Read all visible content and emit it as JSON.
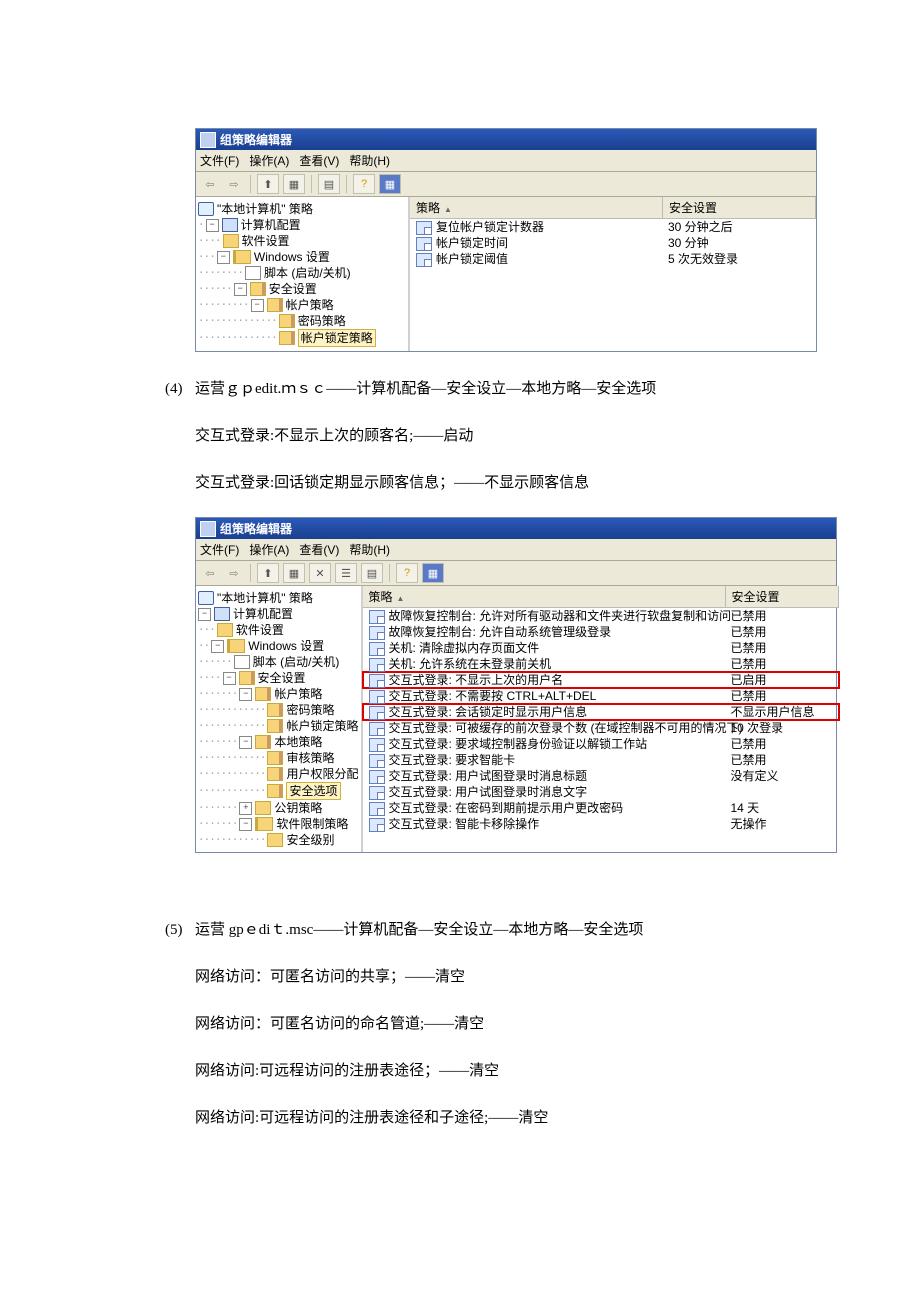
{
  "win1": {
    "title": "组策略编辑器",
    "menu": {
      "file": "文件(F)",
      "action": "操作(A)",
      "view": "查看(V)",
      "help": "帮助(H)"
    },
    "tree": {
      "root": "\"本地计算机\" 策略",
      "comp": "计算机配置",
      "soft": "软件设置",
      "wset": "Windows 设置",
      "script": "脚本 (启动/关机)",
      "sec": "安全设置",
      "acct": "帐户策略",
      "pwd": "密码策略",
      "lock": "帐户锁定策略"
    },
    "hdr": {
      "policy": "策略",
      "setting": "安全设置"
    },
    "rows": [
      {
        "p": "复位帐户锁定计数器",
        "v": "30 分钟之后"
      },
      {
        "p": "帐户锁定时间",
        "v": "30 分钟"
      },
      {
        "p": "帐户锁定阈值",
        "v": "5 次无效登录"
      }
    ]
  },
  "text": {
    "item4": "(4)",
    "p4a": "运营ｇｐedit.ｍｓｃ——计算机配备—安全设立—本地方略—安全选项",
    "p4b": "交互式登录:不显示上次的顾客名;——启动",
    "p4c": "交互式登录:回话锁定期显示顾客信息；——不显示顾客信息",
    "item5": "(5)",
    "p5a": "运营 gpｅdiｔ.msc——计算机配备—安全设立—本地方略—安全选项",
    "p5b": "网络访问：可匿名访问的共享；——清空",
    "p5c": "网络访问：可匿名访问的命名管道;——清空",
    "p5d": "网络访问:可远程访问的注册表途径；——清空",
    "p5e": "网络访问:可远程访问的注册表途径和子途径;——清空"
  },
  "win2": {
    "title": "组策略编辑器",
    "menu": {
      "file": "文件(F)",
      "action": "操作(A)",
      "view": "查看(V)",
      "help": "帮助(H)"
    },
    "tree": {
      "root": "\"本地计算机\" 策略",
      "comp": "计算机配置",
      "soft": "软件设置",
      "wset": "Windows 设置",
      "script": "脚本 (启动/关机)",
      "sec": "安全设置",
      "acct": "帐户策略",
      "pwd": "密码策略",
      "lock": "帐户锁定策略",
      "local": "本地策略",
      "audit": "审核策略",
      "rights": "用户权限分配",
      "secopt": "安全选项",
      "pubkey": "公钥策略",
      "swrest": "软件限制策略",
      "seclvl": "安全级别"
    },
    "hdr": {
      "policy": "策略",
      "setting": "安全设置"
    },
    "rows": [
      {
        "p": "故障恢复控制台: 允许对所有驱动器和文件夹进行软盘复制和访问",
        "v": "已禁用"
      },
      {
        "p": "故障恢复控制台: 允许自动系统管理级登录",
        "v": "已禁用"
      },
      {
        "p": "关机: 清除虚拟内存页面文件",
        "v": "已禁用"
      },
      {
        "p": "关机: 允许系统在未登录前关机",
        "v": "已禁用"
      },
      {
        "p": "交互式登录: 不显示上次的用户名",
        "v": "已启用",
        "hl": true
      },
      {
        "p": "交互式登录: 不需要按 CTRL+ALT+DEL",
        "v": "已禁用"
      },
      {
        "p": "交互式登录: 会话锁定时显示用户信息",
        "v": "不显示用户信息",
        "hl": true
      },
      {
        "p": "交互式登录: 可被缓存的前次登录个数 (在域控制器不可用的情况下)",
        "v": "10 次登录"
      },
      {
        "p": "交互式登录: 要求域控制器身份验证以解锁工作站",
        "v": "已禁用"
      },
      {
        "p": "交互式登录: 要求智能卡",
        "v": "已禁用"
      },
      {
        "p": "交互式登录: 用户试图登录时消息标题",
        "v": "没有定义"
      },
      {
        "p": "交互式登录: 用户试图登录时消息文字",
        "v": ""
      },
      {
        "p": "交互式登录: 在密码到期前提示用户更改密码",
        "v": "14 天"
      },
      {
        "p": "交互式登录: 智能卡移除操作",
        "v": "无操作"
      }
    ]
  }
}
